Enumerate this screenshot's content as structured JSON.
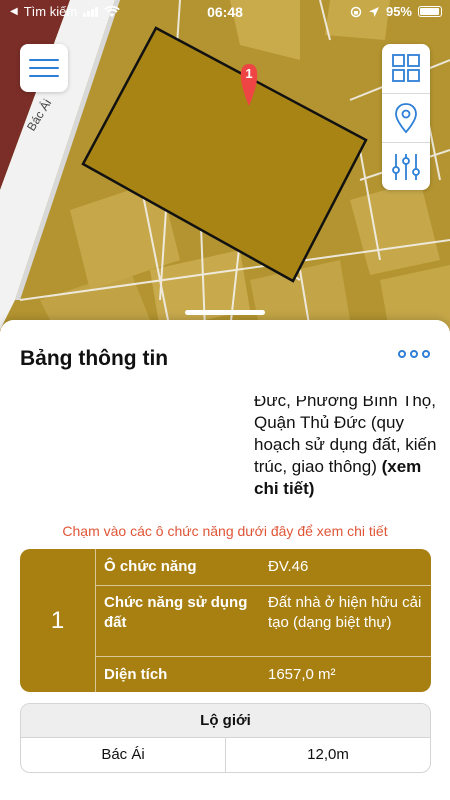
{
  "status_bar": {
    "back_app": "Tìm kiếm",
    "time": "06:48",
    "battery": "95%",
    "battery_level": 0.95
  },
  "map": {
    "street_label": "Bác Ái",
    "pin_label": "1"
  },
  "sheet": {
    "title": "Bảng thông tin",
    "address_text": "Đức, Phường Bình Thọ, Quận Thủ Đức (quy hoạch sử dụng đất, kiến trúc, giao thông) ",
    "address_link": "(xem chi tiết)",
    "hint": "Chạm vào các ô chức năng dưới đây để xem chi tiết",
    "zone": {
      "number": "1",
      "rows": [
        {
          "label": "Ô chức năng",
          "value": "ĐV.46"
        },
        {
          "label": "Chức năng sử dụng đất",
          "value": "Đất nhà ở hiện hữu cải tạo (dạng biệt thự)"
        },
        {
          "label": "Diện tích",
          "value": "1657,0 m²"
        }
      ]
    },
    "road": {
      "header": "Lộ giới",
      "name": "Bác Ái",
      "width": "12,0m"
    }
  },
  "colors": {
    "accent": "#2e7fd6",
    "zone_fill": "#a88012",
    "hint": "#e05536",
    "parcel": "#a78414",
    "pin": "#ef4444"
  }
}
